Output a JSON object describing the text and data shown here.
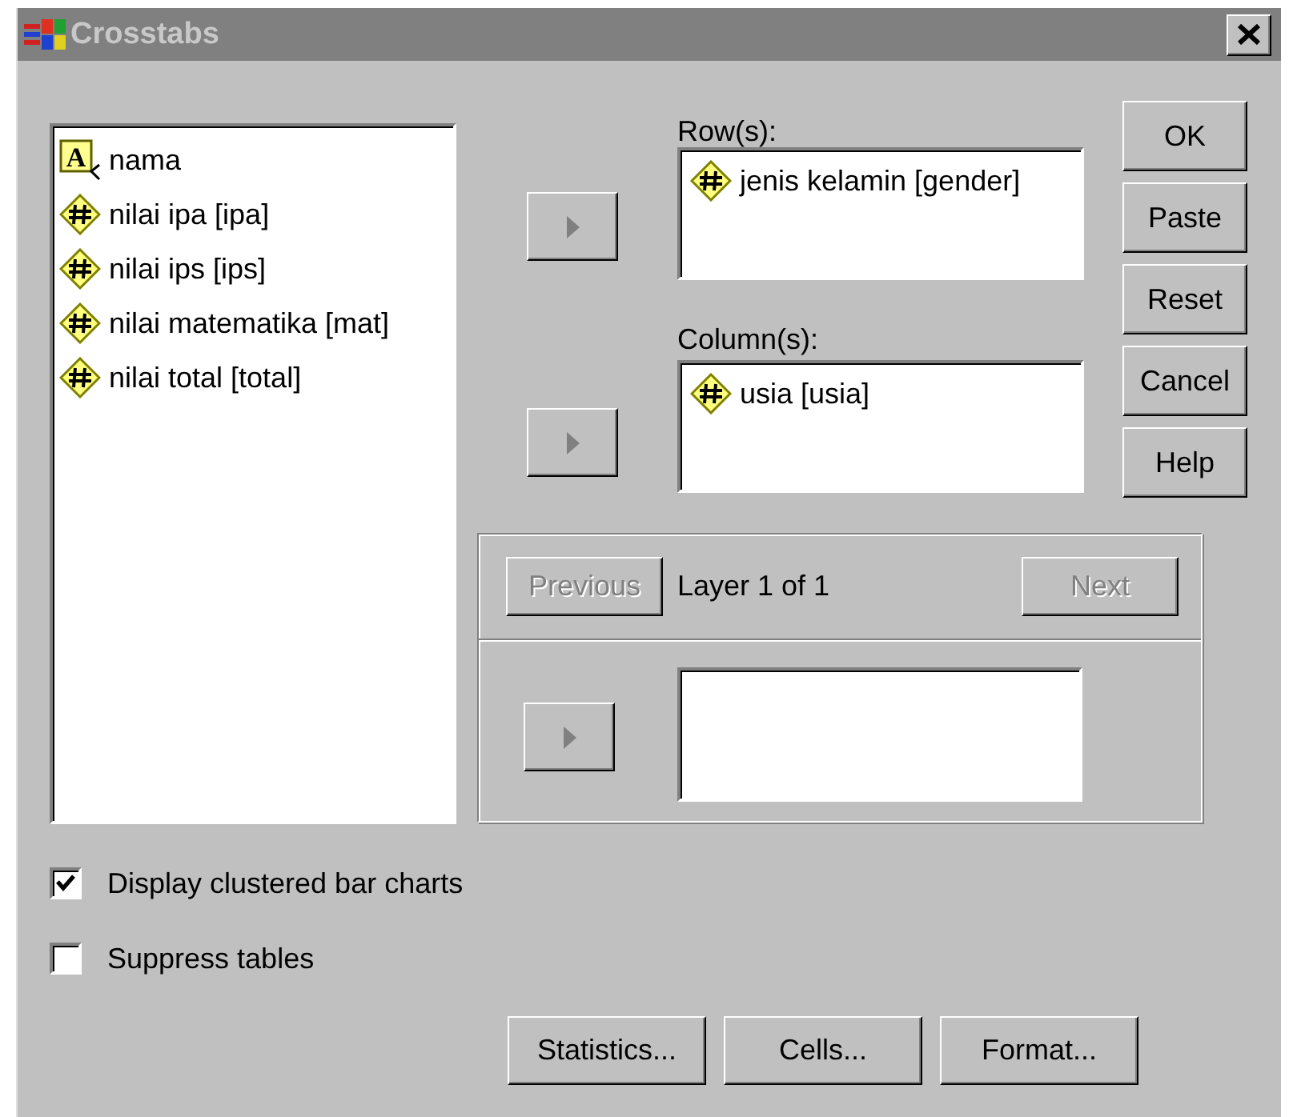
{
  "window": {
    "title": "Crosstabs"
  },
  "variables": [
    {
      "name": "nama",
      "kind": "string",
      "icon_letter": "A"
    },
    {
      "name": "nilai ipa [ipa]",
      "kind": "numeric"
    },
    {
      "name": "nilai ips [ips]",
      "kind": "numeric"
    },
    {
      "name": "nilai matematika [mat]",
      "kind": "numeric"
    },
    {
      "name": "nilai total [total]",
      "kind": "numeric"
    }
  ],
  "arrow_buttons": [
    {
      "disabled": true
    },
    {
      "disabled": true
    },
    {
      "disabled": true
    }
  ],
  "row_box": {
    "label": "Row(s):",
    "items": [
      {
        "name": "jenis kelamin [gender]",
        "kind": "numeric"
      }
    ]
  },
  "column_box": {
    "label": "Column(s):",
    "items": [
      {
        "name": "usia [usia]",
        "kind": "numeric"
      }
    ]
  },
  "buttons": [
    {
      "label": "OK"
    },
    {
      "label": "Paste"
    },
    {
      "label": "Reset"
    },
    {
      "label": "Cancel"
    },
    {
      "label": "Help"
    }
  ],
  "layer": {
    "previous": {
      "label": "Previous",
      "disabled": true
    },
    "text": "Layer 1 of 1",
    "next": {
      "label": "Next",
      "disabled": true
    }
  },
  "options": [
    {
      "label": "Display clustered bar charts",
      "checked": true
    },
    {
      "label": "Suppress tables",
      "checked": false
    }
  ],
  "bottom_buttons": [
    {
      "label": "Statistics..."
    },
    {
      "label": "Cells..."
    },
    {
      "label": "Format..."
    }
  ]
}
